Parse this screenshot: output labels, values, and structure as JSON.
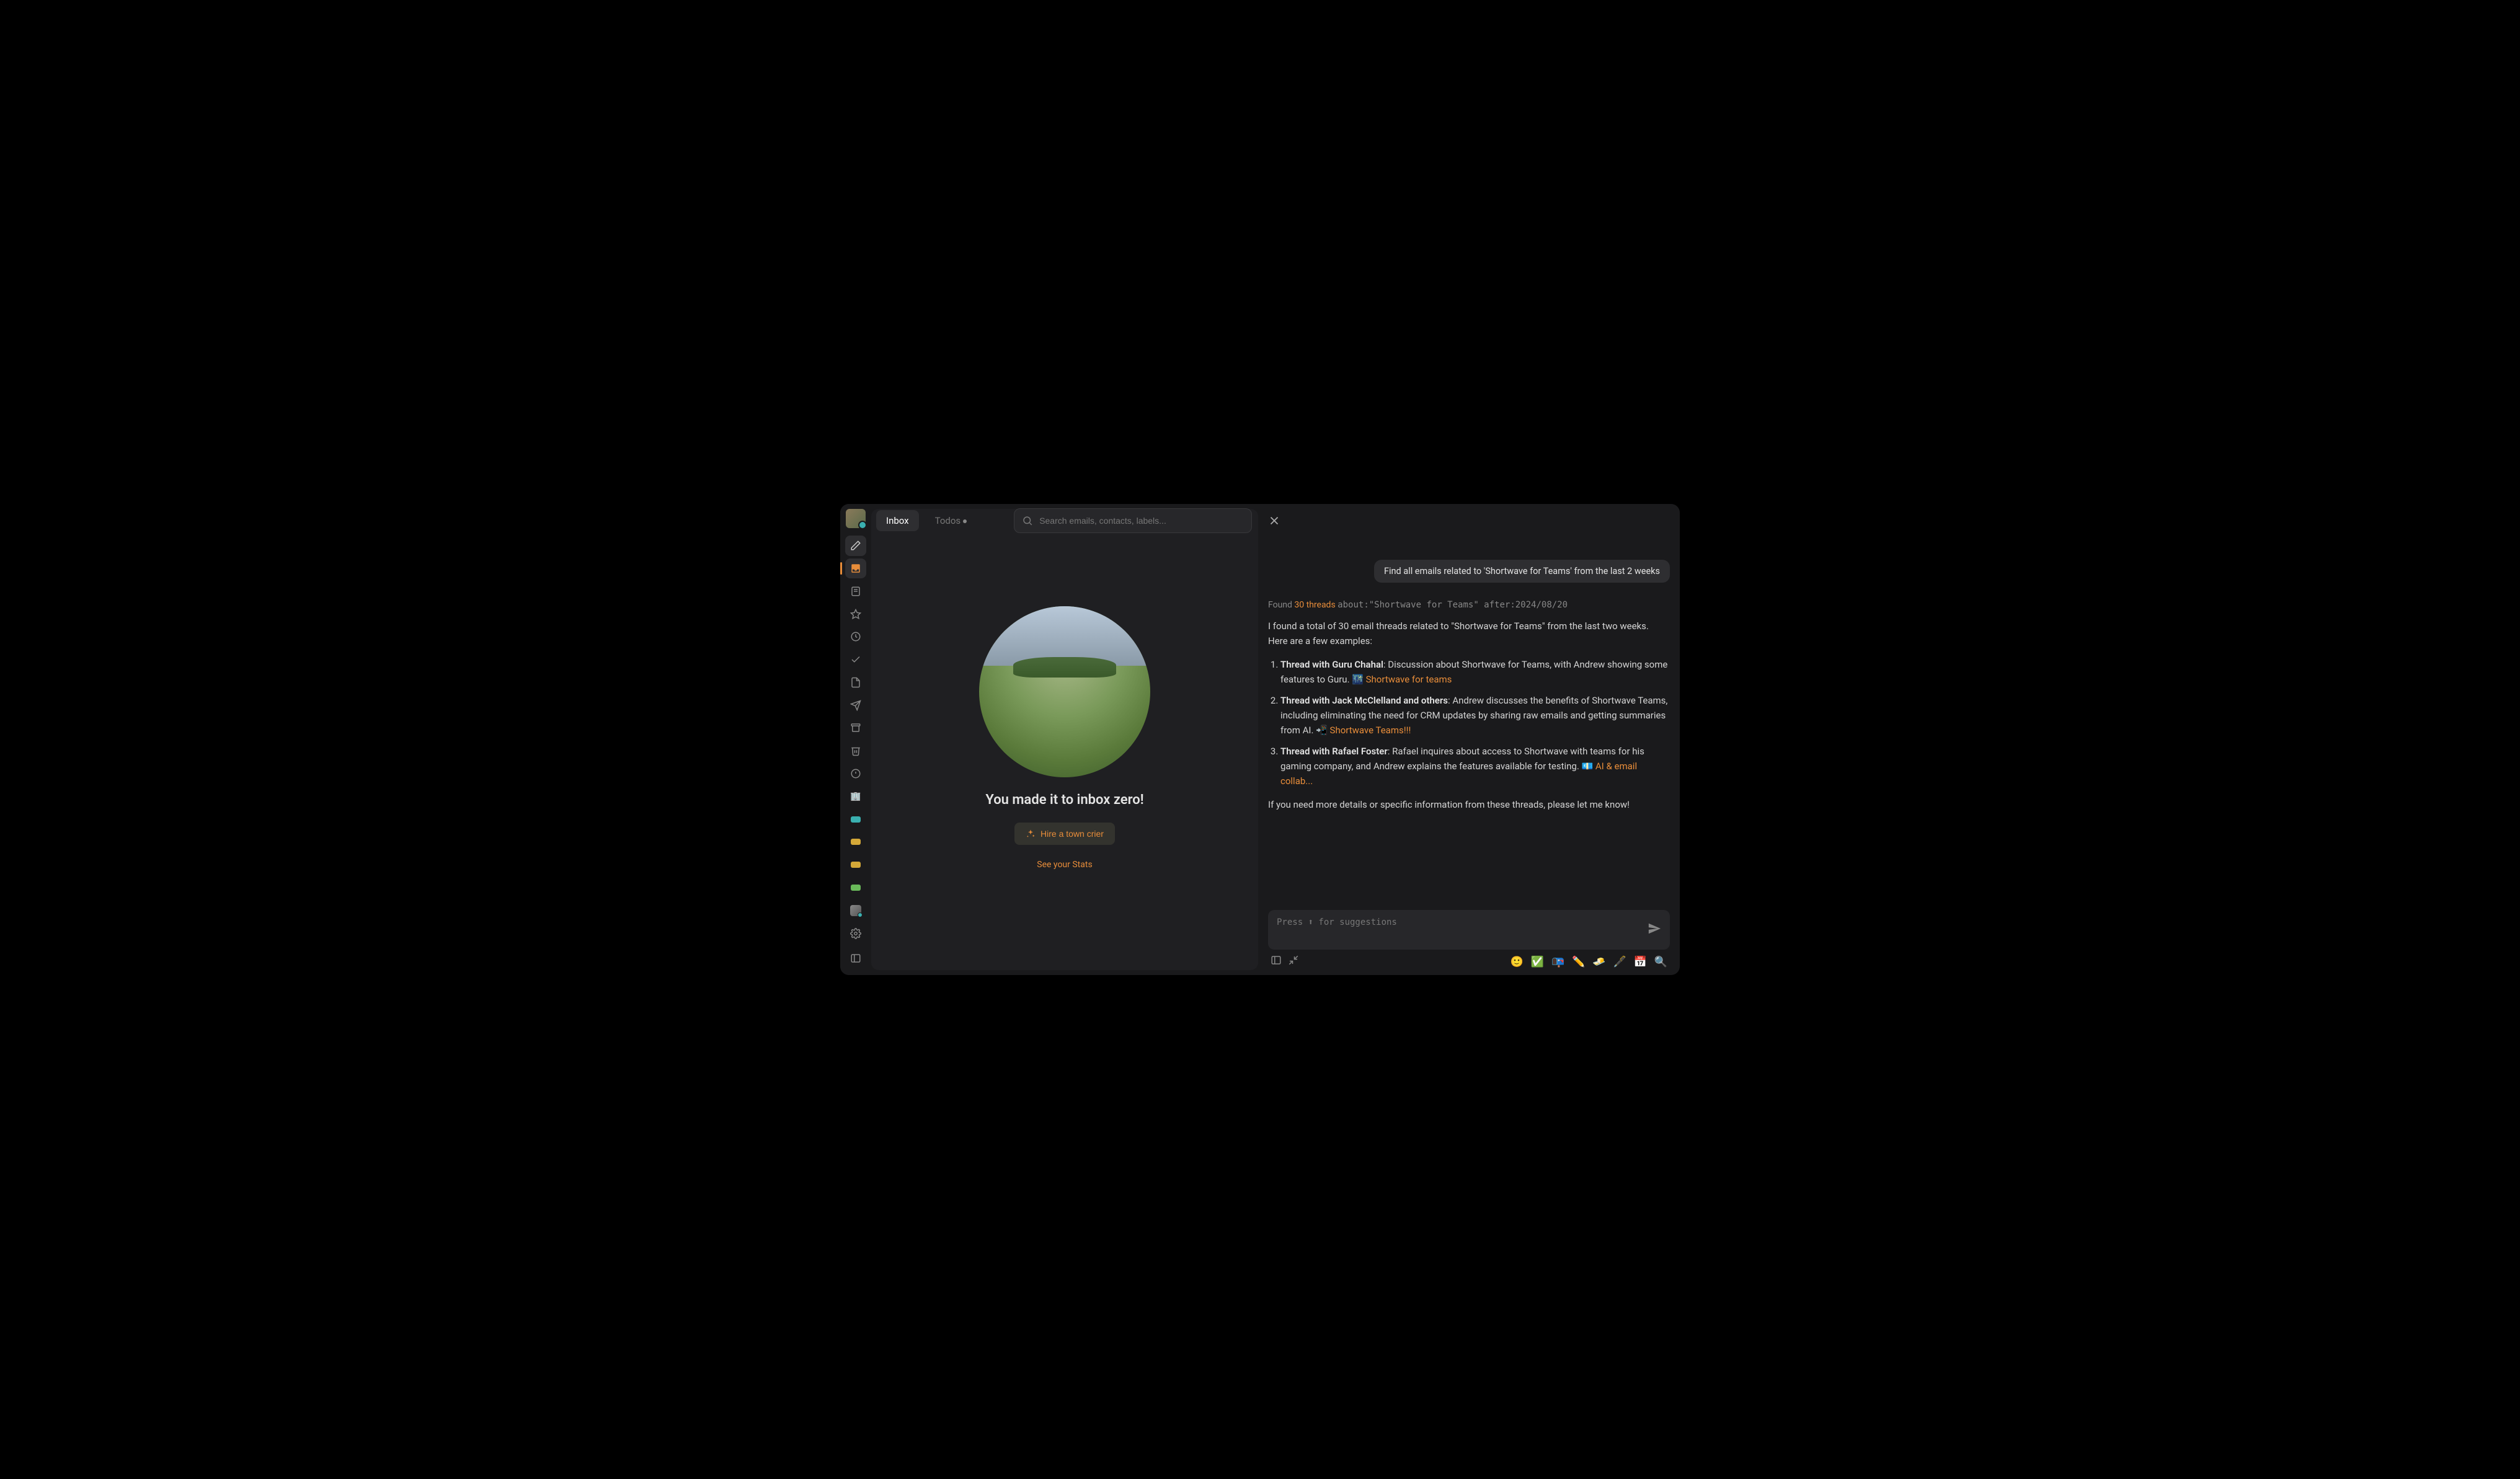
{
  "tabs": {
    "inbox": "Inbox",
    "todos": "Todos"
  },
  "search": {
    "placeholder": "Search emails, contacts, labels..."
  },
  "inbox_zero": {
    "title": "You made it to inbox zero!",
    "hire_button": "Hire a town crier",
    "stats_link": "See your Stats"
  },
  "chat": {
    "user_query": "Find all emails related to 'Shortwave for Teams' from the last 2 weeks",
    "found_prefix": "Found ",
    "found_count": "30 threads",
    "found_query": "about:\"Shortwave for Teams\" after:2024/08/20",
    "intro": "I found a total of 30 email threads related to \"Shortwave for Teams\" from the last two weeks. Here are a few examples:",
    "items": [
      {
        "title": "Thread with Guru Chahal",
        "body": ": Discussion about Shortwave for Teams, with Andrew showing some features to Guru. 🌃 ",
        "link": "Shortwave for teams"
      },
      {
        "title": "Thread with Jack McClelland and others",
        "body": ": Andrew discusses the benefits of Shortwave Teams, including eliminating the need for CRM updates by sharing raw emails and getting summaries from AI. 📲 ",
        "link": "Shortwave Teams!!!"
      },
      {
        "title": "Thread with Rafael Foster",
        "body": ": Rafael inquires about access to Shortwave with teams for his gaming company, and Andrew explains the features available for testing. 💶 ",
        "link": "AI & email collab..."
      }
    ],
    "outro": "If you need more details or specific information from these threads, please let me know!",
    "input_placeholder": "Press ⬆ for suggestions"
  },
  "emoji_bar": [
    "🙂",
    "✅",
    "📭",
    "✏️",
    "🧈",
    "🖋️",
    "📅",
    "🔍"
  ]
}
